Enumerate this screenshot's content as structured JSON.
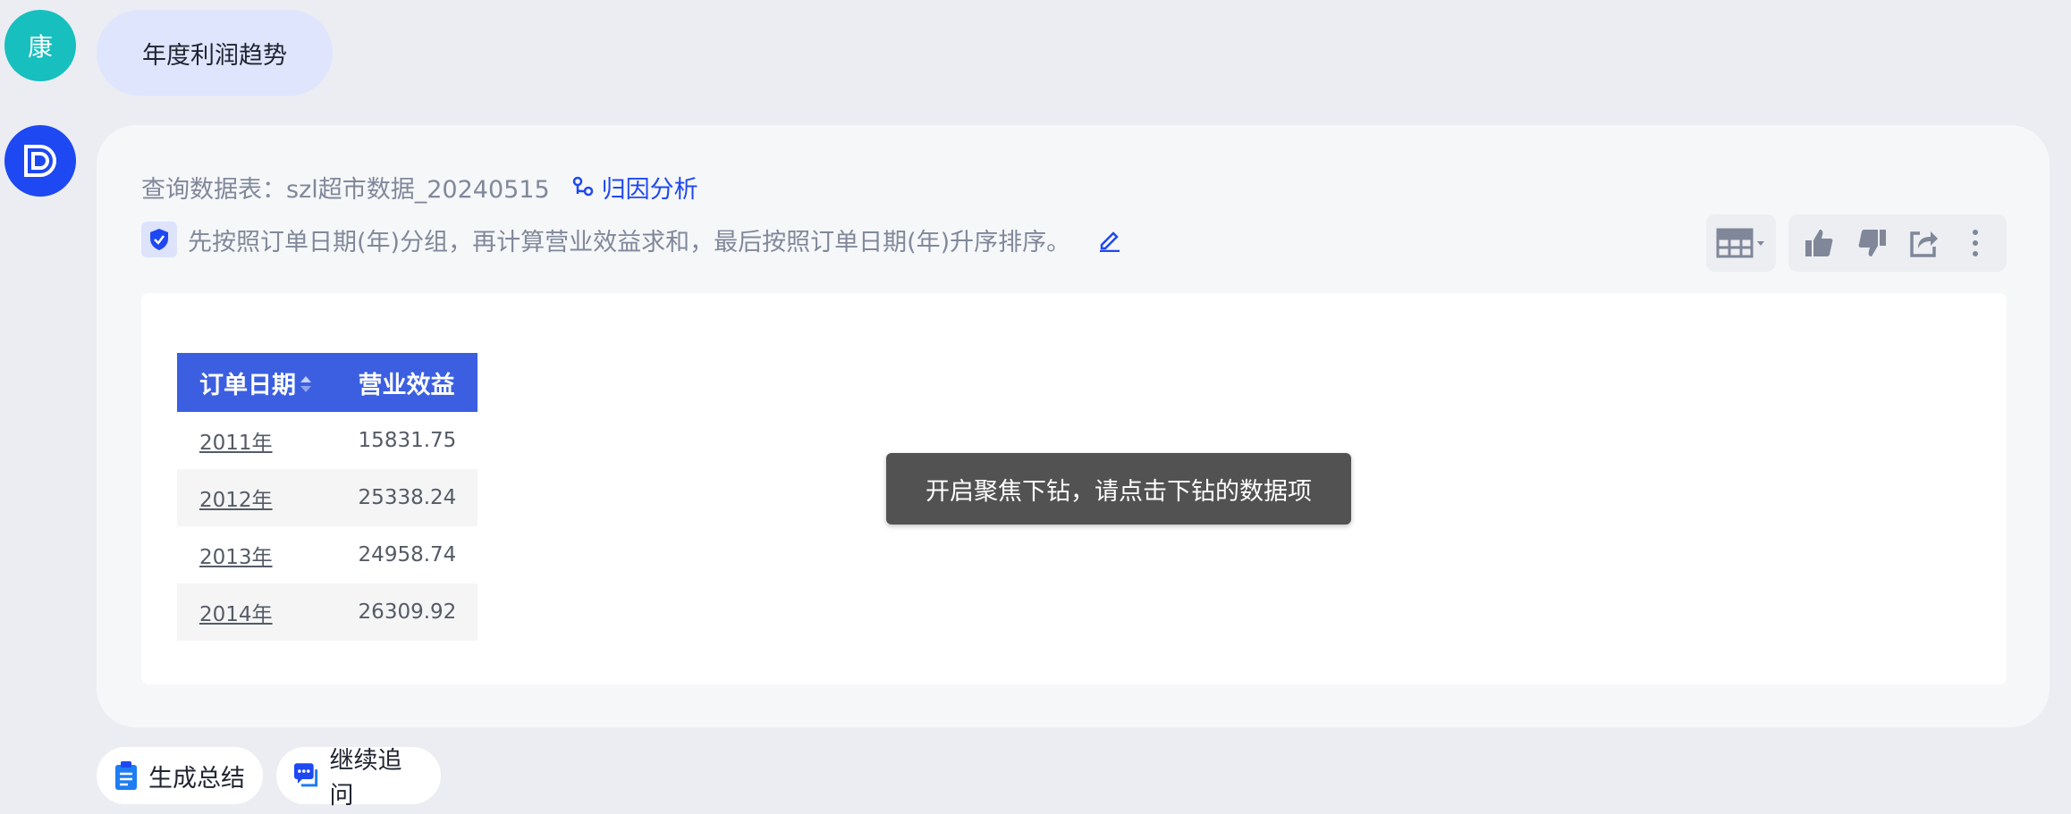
{
  "user": {
    "avatar_text": "康",
    "avatar_color": "#17bfbf",
    "message": "年度利润趋势"
  },
  "assistant": {
    "avatar_color": "#1e48f2",
    "query_prefix": "查询数据表：",
    "table_name": "szl超市数据_20240515",
    "attribution_label": "归因分析",
    "description": "先按照订单日期(年)分组，再计算营业效益求和，最后按照订单日期(年)升序排序。"
  },
  "table": {
    "headers": [
      "订单日期",
      "营业效益"
    ],
    "rows": [
      [
        "2011年",
        "15831.75"
      ],
      [
        "2012年",
        "25338.24"
      ],
      [
        "2013年",
        "24958.74"
      ],
      [
        "2014年",
        "26309.92"
      ]
    ]
  },
  "toast": "开启聚焦下钻，请点击下钻的数据项",
  "actions": {
    "summary_label": "生成总结",
    "followup_label": "继续追问"
  },
  "colors": {
    "accent": "#1e48f2",
    "table_header": "#3b5fe0"
  }
}
